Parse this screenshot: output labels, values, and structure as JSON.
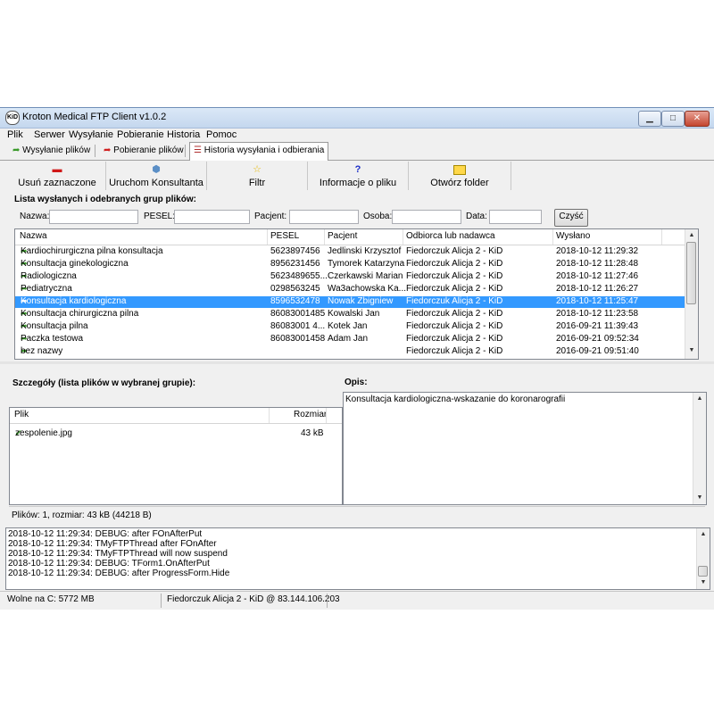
{
  "window": {
    "title": "Kroton Medical FTP Client v1.0.2",
    "app_icon_text": "KiD"
  },
  "menu": [
    "Plik",
    "Serwer",
    "Wysyłanie",
    "Pobieranie",
    "Historia",
    "Pomoc"
  ],
  "tabs": [
    {
      "label": "Wysyłanie plików",
      "icon": "send-arrow-icon"
    },
    {
      "label": "Pobieranie plików",
      "icon": "download-arrow-icon"
    },
    {
      "label": "Historia wysyłania i odbierania",
      "icon": "history-list-icon",
      "active": true
    }
  ],
  "toolbar": {
    "delete_label": "Usuń zaznaczone",
    "run_consultant_label": "Uruchom Konsultanta",
    "filter_label": "Filtr",
    "file_info_label": "Informacje o pliku",
    "open_folder_label": "Otwórz folder",
    "file_info_glyph": "?"
  },
  "groups_section": {
    "title": "Lista wysłanych i odebranych grup plików:",
    "filters": {
      "name_label": "Nazwa:",
      "pesel_label": "PESEL:",
      "patient_label": "Pacjent:",
      "person_label": "Osoba:",
      "date_label": "Data:",
      "clear_button": "Czyść"
    },
    "columns": [
      "Nazwa",
      "PESEL",
      "Pacjent",
      "Odbiorca lub nadawca",
      "Wysłano"
    ],
    "rows": [
      {
        "name": "Kardiochirurgiczna pilna konsultacja",
        "pesel": "5623897456",
        "patient": "Jedlinski Krzysztof",
        "party": "Fiedorczuk Alicja 2 - KiD",
        "sent": "2018-10-12 11:29:32"
      },
      {
        "name": "Konsultacja ginekologiczna",
        "pesel": "8956231456",
        "patient": "Tymorek Katarzyna",
        "party": "Fiedorczuk Alicja 2 - KiD",
        "sent": "2018-10-12 11:28:48"
      },
      {
        "name": "Radiologiczna",
        "pesel": "5623489655...",
        "patient": "Czerkawski Marian",
        "party": "Fiedorczuk Alicja 2 - KiD",
        "sent": "2018-10-12 11:27:46"
      },
      {
        "name": "Pediatryczna",
        "pesel": "0298563245",
        "patient": "Wa3achowska Ka...",
        "party": "Fiedorczuk Alicja 2 - KiD",
        "sent": "2018-10-12 11:26:27"
      },
      {
        "name": "Konsultacja kardiologiczna",
        "pesel": "8596532478",
        "patient": "Nowak Zbigniew",
        "party": "Fiedorczuk Alicja 2 - KiD",
        "sent": "2018-10-12 11:25:47",
        "selected": true
      },
      {
        "name": "Konsultacja chirurgiczna pilna",
        "pesel": "86083001485",
        "patient": "Kowalski Jan",
        "party": "Fiedorczuk Alicja 2 - KiD",
        "sent": "2018-10-12 11:23:58"
      },
      {
        "name": "Konsultacja pilna",
        "pesel": "86083001 4...",
        "patient": "Kotek Jan",
        "party": "Fiedorczuk Alicja 2 - KiD",
        "sent": "2016-09-21 11:39:43"
      },
      {
        "name": "Paczka testowa",
        "pesel": "86083001458",
        "patient": "Adam Jan",
        "party": "Fiedorczuk Alicja 2 - KiD",
        "sent": "2016-09-21 09:52:34"
      },
      {
        "name": "bez nazwy",
        "pesel": "",
        "patient": "",
        "party": "Fiedorczuk Alicja 2 - KiD",
        "sent": "2016-09-21 09:51:40"
      }
    ]
  },
  "details": {
    "title": "Szczegóły (lista plików w wybranej grupie):",
    "columns": [
      "Plik",
      "Rozmiar"
    ],
    "files": [
      {
        "name": "zespolenie.jpg",
        "size": "43 kB"
      }
    ],
    "summary": "Plików: 1, rozmiar: 43 kB (44218 B)"
  },
  "description": {
    "title": "Opis:",
    "text": "Konsultacja kardiologiczna-wskazanie do koronarografii"
  },
  "log": [
    "2018-10-12 11:29:34: DEBUG: after FOnAfterPut",
    "2018-10-12 11:29:34: TMyFTPThread after FOnAfter",
    "2018-10-12 11:29:34: TMyFTPThread will now suspend",
    "2018-10-12 11:29:34: DEBUG: TForm1.OnAfterPut",
    "2018-10-12 11:29:34: DEBUG: after ProgressForm.Hide"
  ],
  "statusbar": {
    "free_space": "Wolne na C: 5772 MB",
    "connection": "Fiedorczuk Alicja 2 - KiD @ 83.144.106.203"
  }
}
